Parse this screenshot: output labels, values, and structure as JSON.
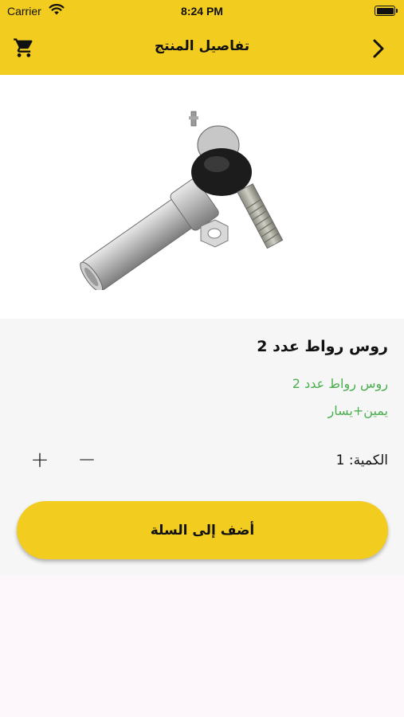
{
  "status_bar": {
    "carrier": "Carrier",
    "time": "8:24 PM",
    "wifi_icon": "wifi-icon",
    "battery_icon": "battery-icon"
  },
  "navbar": {
    "title": "تفاصيل المنتج",
    "cart_icon": "cart-icon",
    "back_icon": "chevron-right-icon",
    "background_color": "#f2cc1f"
  },
  "product": {
    "image_alt": "tie rod end",
    "title": "روس رواط عدد 2",
    "description_lines": [
      "روس رواط عدد 2",
      "يمين+يسار"
    ],
    "description_color": "#4caf50"
  },
  "quantity": {
    "label": "الكمية: 1",
    "plus_symbol": "+",
    "minus_symbol": "−"
  },
  "actions": {
    "add_to_cart_label": "أضف إلى السلة",
    "button_color": "#f2cc1f"
  }
}
